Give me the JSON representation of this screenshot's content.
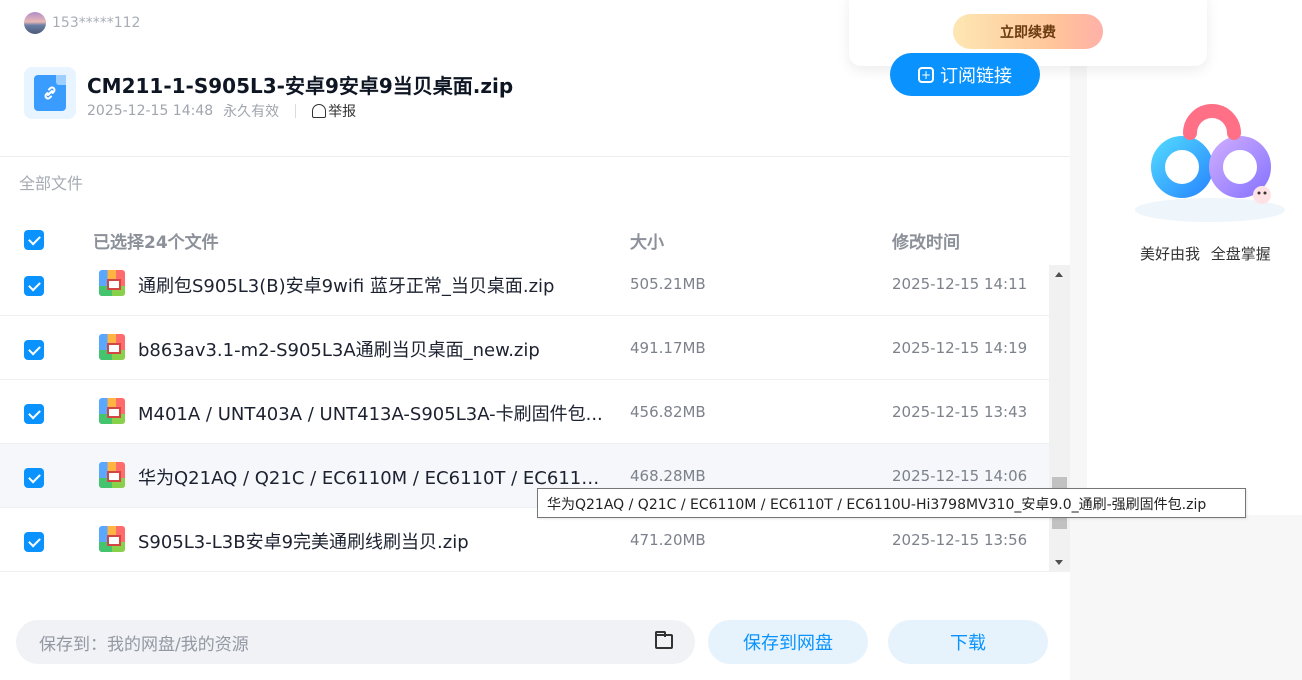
{
  "user": {
    "name": "153*****112"
  },
  "renew": {
    "label": "立即续费"
  },
  "file": {
    "title": "CM211-1-S905L3-安卓9安卓9当贝桌面.zip",
    "date": "2025-12-15 14:48",
    "validity": "永久有效",
    "report_label": "举报"
  },
  "subscribe": {
    "label": "订阅链接"
  },
  "breadcrumb": {
    "all_files": "全部文件"
  },
  "table": {
    "header_selected": "已选择24个文件",
    "header_size": "大小",
    "header_time": "修改时间",
    "rows": [
      {
        "name": "通刷包S905L3(B)安卓9wifi 蓝牙正常_当贝桌面.zip",
        "size": "505.21MB",
        "time": "2025-12-15 14:11"
      },
      {
        "name": "b863av3.1-m2-S905L3A通刷当贝桌面_new.zip",
        "size": "491.17MB",
        "time": "2025-12-15 14:19"
      },
      {
        "name": "M401A / UNT403A / UNT413A-S905L3A-卡刷固件包...",
        "size": "456.82MB",
        "time": "2025-12-15 13:43"
      },
      {
        "name": "华为Q21AQ / Q21C / EC6110M / EC6110T / EC6110U-...",
        "size": "468.28MB",
        "time": "2025-12-15 14:06"
      },
      {
        "name": "S905L3-L3B安卓9完美通刷线刷当贝.zip",
        "size": "471.20MB",
        "time": "2025-12-15 13:56"
      }
    ]
  },
  "tooltip": {
    "text": "华为Q21AQ / Q21C / EC6110M / EC6110T / EC6110U-Hi3798MV310_安卓9.0_通刷-强刷固件包.zip"
  },
  "save": {
    "path": "保存到：我的网盘/我的资源",
    "save_button": "保存到网盘",
    "download_button": "下载"
  },
  "promo": {
    "slogan": "美好由我 全盘掌握"
  },
  "colors": {
    "accent": "#0a93ff",
    "accent_light": "#e6f3fd"
  }
}
